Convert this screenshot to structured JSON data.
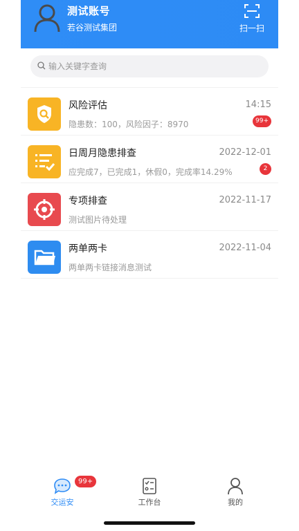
{
  "header": {
    "user_name": "测试账号",
    "org_name": "若谷测试集团",
    "scan_label": "扫一扫",
    "bg_color": "#2d8bf5"
  },
  "search": {
    "placeholder": "输入关键字查询"
  },
  "messages": [
    {
      "title": "风险评估",
      "time": "14:15",
      "subtitle": "隐患数：100，风险因子：8970",
      "badge": "99+",
      "icon": "shield-search-icon",
      "color": "#f8b425"
    },
    {
      "title": "日周月隐患排查",
      "time": "2022-12-01",
      "subtitle": "应完成7，已完成1，休假0，完成率14.29%",
      "badge": "2",
      "icon": "checklist-icon",
      "color": "#f8b425"
    },
    {
      "title": "专项排查",
      "time": "2022-11-17",
      "subtitle": "测试图片待处理",
      "icon": "target-icon",
      "color": "#e84a4f"
    },
    {
      "title": "两单两卡",
      "time": "2022-11-04",
      "subtitle": "两单两卡链接消息测试",
      "icon": "folder-icon",
      "color": "#2e8cf0"
    }
  ],
  "tabbar": {
    "tabs": [
      {
        "label": "交运安",
        "icon": "chat-icon",
        "badge": "99+",
        "active": true
      },
      {
        "label": "工作台",
        "icon": "clipboard-icon",
        "active": false
      },
      {
        "label": "我的",
        "icon": "person-icon",
        "active": false
      }
    ]
  }
}
